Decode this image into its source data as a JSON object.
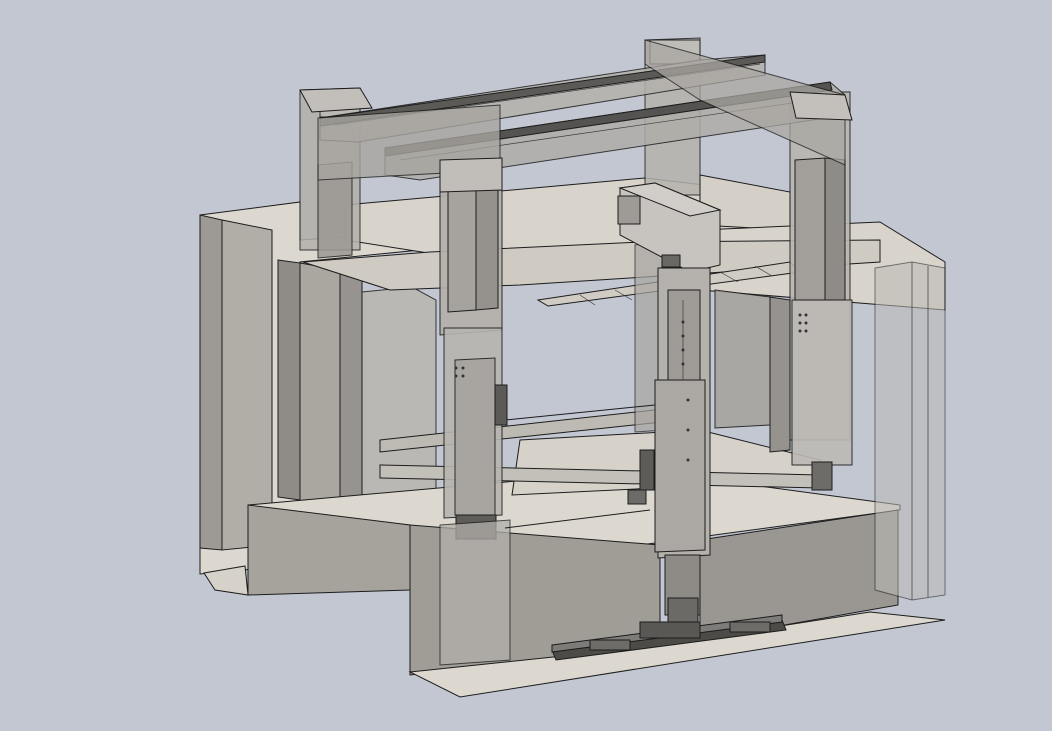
{
  "viewport": {
    "background": "#c2c7d2",
    "model": "gantry-frame-assembly",
    "render_style": "shaded-transparent-with-edges"
  },
  "colors": {
    "floor_slab": "#dcd8d0",
    "concrete_front": "#a6a39d",
    "concrete_side": "#8e8b86",
    "steel_dark": "#5a5a5a",
    "glass": "#b8b6b0"
  }
}
